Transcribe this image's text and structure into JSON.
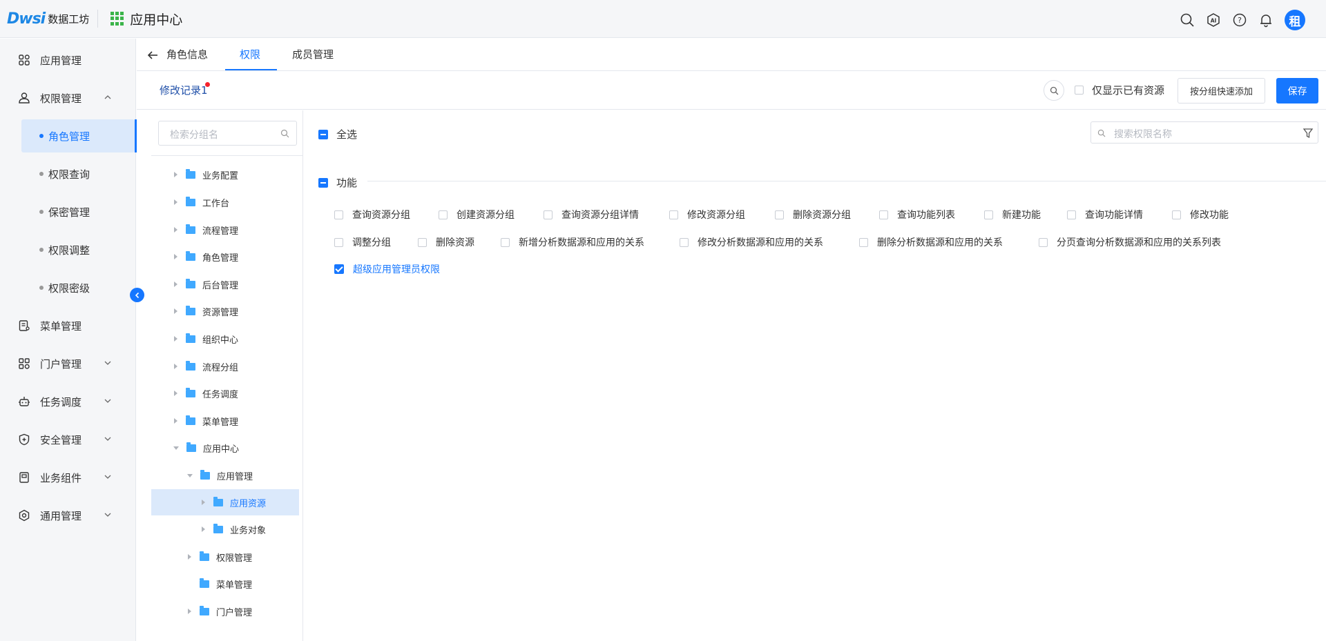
{
  "header": {
    "logo_mark": "Dwsi",
    "logo_text": "数据工坊",
    "app_title": "应用中心",
    "avatar_text": "租",
    "icons": [
      "search-icon",
      "ai-icon",
      "help-icon",
      "bell-icon"
    ]
  },
  "sidebar": {
    "items": [
      {
        "label": "应用管理",
        "icon": "apps-icon"
      },
      {
        "label": "权限管理",
        "icon": "user-lock-icon"
      },
      {
        "label": "菜单管理",
        "icon": "menu-doc-icon"
      },
      {
        "label": "门户管理",
        "icon": "portal-icon"
      },
      {
        "label": "任务调度",
        "icon": "robot-icon"
      },
      {
        "label": "安全管理",
        "icon": "shield-icon"
      },
      {
        "label": "业务组件",
        "icon": "component-icon"
      },
      {
        "label": "通用管理",
        "icon": "settings-icon"
      }
    ],
    "sub_items": [
      "角色管理",
      "权限查询",
      "保密管理",
      "权限调整",
      "权限密级"
    ]
  },
  "tabs": [
    "角色信息",
    "权限",
    "成员管理"
  ],
  "toolbar": {
    "history_label": "修改记录1",
    "only_existing_label": "仅显示已有资源",
    "quick_add_label": "按分组快速添加",
    "save_label": "保存"
  },
  "tree": {
    "search_placeholder": "检索分组名",
    "nodes": [
      "业务配置",
      "工作台",
      "流程管理",
      "角色管理",
      "后台管理",
      "资源管理",
      "组织中心",
      "流程分组",
      "任务调度",
      "菜单管理",
      "应用中心",
      "应用管理",
      "应用资源",
      "业务对象",
      "权限管理",
      "菜单管理",
      "门户管理"
    ]
  },
  "permissions": {
    "select_all_label": "全选",
    "search_placeholder": "搜索权限名称",
    "group_label": "功能",
    "items": [
      "查询资源分组",
      "创建资源分组",
      "查询资源分组详情",
      "修改资源分组",
      "删除资源分组",
      "查询功能列表",
      "新建功能",
      "查询功能详情",
      "修改功能",
      "调整分组",
      "删除资源",
      "新增分析数据源和应用的关系",
      "修改分析数据源和应用的关系",
      "删除分析数据源和应用的关系",
      "分页查询分析数据源和应用的关系列表",
      "超级应用管理员权限"
    ]
  },
  "colors": {
    "accent": "#1677ff",
    "folder": "#40a9ff",
    "logo_green": "#3bb44a",
    "badge_red": "#f5222d"
  }
}
